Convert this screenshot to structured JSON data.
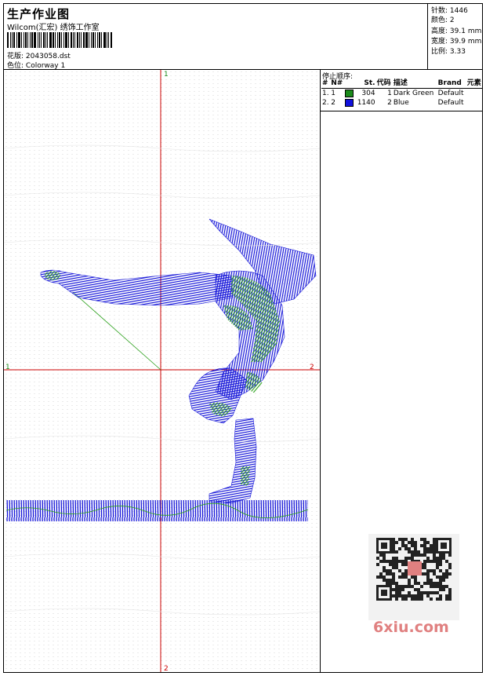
{
  "header": {
    "title": "生产作业图",
    "subtitle": "Wilcom(汇宏) 绣饰工作室",
    "design_file_label": "花版:",
    "design_file": "2043058.dst",
    "colorway_label": "色位:",
    "colorway": "Colorway 1"
  },
  "stats": {
    "stitches_label": "针数:",
    "stitches": "1446",
    "colors_label": "颜色:",
    "colors": "2",
    "height_label": "高度:",
    "height": "39.1 mm",
    "width_label": "宽度:",
    "width": "39.9 mm",
    "scale_label": "比例:",
    "scale": "3.33"
  },
  "stop_sequence": {
    "caption": "停止顺序:",
    "columns": [
      "#",
      "N#",
      "St.",
      "代码",
      "描述",
      "Brand",
      "元素"
    ],
    "rows": [
      {
        "idx": "1.",
        "n": "1",
        "st": "304",
        "code": "1",
        "desc": "Dark Green",
        "brand": "Default",
        "color": "#1a8a1a"
      },
      {
        "idx": "2.",
        "n": "2",
        "st": "1140",
        "code": "2",
        "desc": "Blue",
        "brand": "Default",
        "color": "#1010dd"
      }
    ]
  },
  "crosshair": {
    "top_label": "1",
    "bottom_label": "2",
    "left_label": "1",
    "right_label": "2",
    "color": "#cc0000"
  },
  "thread_colors": {
    "green": "#2aa01a",
    "blue": "#1414d8"
  },
  "watermark": {
    "text": "6xiu.com",
    "color": "#e08080"
  }
}
